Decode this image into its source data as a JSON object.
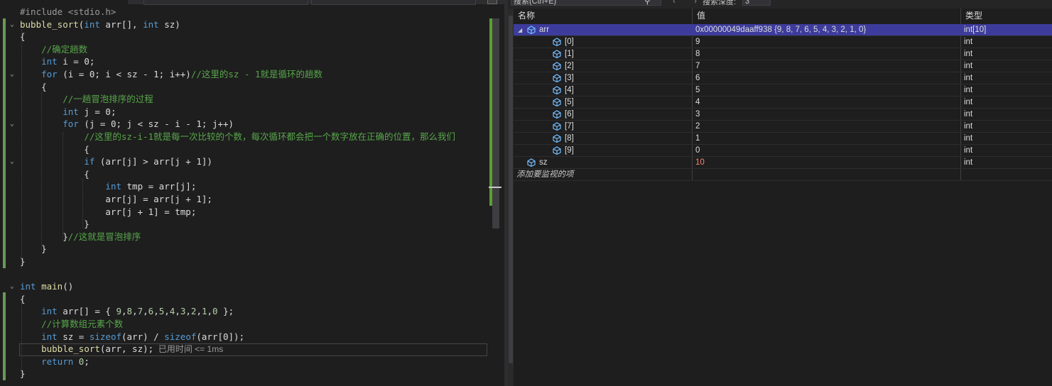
{
  "editor": {
    "lines": [
      {
        "fold": "",
        "html": [
          [
            "pp",
            "#include <stdio.h>"
          ]
        ]
      },
      {
        "fold": "v",
        "html": [
          [
            "fn",
            "bubble_sort"
          ],
          [
            "id",
            "("
          ],
          [
            "kw",
            "int"
          ],
          [
            "id",
            " arr[], "
          ],
          [
            "kw",
            "int"
          ],
          [
            "id",
            " sz)"
          ]
        ]
      },
      {
        "fold": "",
        "html": [
          [
            "id",
            "{"
          ]
        ]
      },
      {
        "fold": "",
        "html": [
          [
            "id",
            "    "
          ],
          [
            "cm",
            "//确定趟数"
          ]
        ]
      },
      {
        "fold": "",
        "html": [
          [
            "id",
            "    "
          ],
          [
            "kw",
            "int"
          ],
          [
            "id",
            " i = 0;"
          ]
        ]
      },
      {
        "fold": "v",
        "html": [
          [
            "id",
            "    "
          ],
          [
            "kw",
            "for"
          ],
          [
            "id",
            " (i = 0; i < sz - 1; i++)"
          ],
          [
            "cm",
            "//这里的sz - 1就是循环的趟数"
          ]
        ]
      },
      {
        "fold": "",
        "html": [
          [
            "id",
            "    {"
          ]
        ]
      },
      {
        "fold": "",
        "html": [
          [
            "id",
            "        "
          ],
          [
            "cm",
            "//一趟冒泡排序的过程"
          ]
        ]
      },
      {
        "fold": "",
        "html": [
          [
            "id",
            "        "
          ],
          [
            "kw",
            "int"
          ],
          [
            "id",
            " j = 0;"
          ]
        ]
      },
      {
        "fold": "v",
        "html": [
          [
            "id",
            "        "
          ],
          [
            "kw",
            "for"
          ],
          [
            "id",
            " (j = 0; j < sz - i - 1; j++)"
          ]
        ]
      },
      {
        "fold": "",
        "html": [
          [
            "id",
            "            "
          ],
          [
            "cm",
            "//这里的sz-i-1就是每一次比较的个数，每次循环都会把一个数字放在正确的位置，那么我们"
          ]
        ]
      },
      {
        "fold": "",
        "html": [
          [
            "id",
            "            {"
          ]
        ]
      },
      {
        "fold": "v",
        "html": [
          [
            "id",
            "            "
          ],
          [
            "kw",
            "if"
          ],
          [
            "id",
            " (arr[j] > arr[j + 1])"
          ]
        ]
      },
      {
        "fold": "",
        "html": [
          [
            "id",
            "            {"
          ]
        ]
      },
      {
        "fold": "",
        "html": [
          [
            "id",
            "                "
          ],
          [
            "kw",
            "int"
          ],
          [
            "id",
            " tmp = arr[j];"
          ]
        ]
      },
      {
        "fold": "",
        "html": [
          [
            "id",
            "                arr[j] = arr[j + 1];"
          ]
        ]
      },
      {
        "fold": "",
        "html": [
          [
            "id",
            "                arr[j + 1] = tmp;"
          ]
        ]
      },
      {
        "fold": "",
        "html": [
          [
            "id",
            "            }"
          ]
        ]
      },
      {
        "fold": "",
        "html": [
          [
            "id",
            "        }"
          ],
          [
            "cm",
            "//这就是冒泡排序"
          ]
        ]
      },
      {
        "fold": "",
        "html": [
          [
            "id",
            "    }"
          ]
        ]
      },
      {
        "fold": "",
        "html": [
          [
            "id",
            "}"
          ]
        ]
      },
      {
        "fold": "",
        "html": [
          [
            "id",
            ""
          ]
        ]
      },
      {
        "fold": "v",
        "html": [
          [
            "kw",
            "int"
          ],
          [
            "id",
            " "
          ],
          [
            "fn",
            "main"
          ],
          [
            "id",
            "()"
          ]
        ]
      },
      {
        "fold": "",
        "html": [
          [
            "id",
            "{"
          ]
        ]
      },
      {
        "fold": "",
        "html": [
          [
            "id",
            "    "
          ],
          [
            "kw",
            "int"
          ],
          [
            "id",
            " arr[] = { "
          ],
          [
            "nm",
            "9"
          ],
          [
            "id",
            ","
          ],
          [
            "nm",
            "8"
          ],
          [
            "id",
            ","
          ],
          [
            "nm",
            "7"
          ],
          [
            "id",
            ","
          ],
          [
            "nm",
            "6"
          ],
          [
            "id",
            ","
          ],
          [
            "nm",
            "5"
          ],
          [
            "id",
            ","
          ],
          [
            "nm",
            "4"
          ],
          [
            "id",
            ","
          ],
          [
            "nm",
            "3"
          ],
          [
            "id",
            ","
          ],
          [
            "nm",
            "2"
          ],
          [
            "id",
            ","
          ],
          [
            "nm",
            "1"
          ],
          [
            "id",
            ","
          ],
          [
            "nm",
            "0"
          ],
          [
            "id",
            " };"
          ]
        ]
      },
      {
        "fold": "",
        "html": [
          [
            "id",
            "    "
          ],
          [
            "cm",
            "//计算数组元素个数"
          ]
        ]
      },
      {
        "fold": "",
        "html": [
          [
            "id",
            "    "
          ],
          [
            "kw",
            "int"
          ],
          [
            "id",
            " sz = "
          ],
          [
            "kw",
            "sizeof"
          ],
          [
            "id",
            "(arr) / "
          ],
          [
            "kw",
            "sizeof"
          ],
          [
            "id",
            "(arr[0]);"
          ]
        ]
      },
      {
        "fold": "",
        "html": [
          [
            "id",
            "    "
          ],
          [
            "fn",
            "bubble_sort"
          ],
          [
            "id",
            "(arr, sz);"
          ]
        ]
      },
      {
        "fold": "",
        "html": [
          [
            "id",
            "    "
          ],
          [
            "kw",
            "return"
          ],
          [
            "id",
            " "
          ],
          [
            "nm",
            "0"
          ],
          [
            "id",
            ";"
          ]
        ]
      },
      {
        "fold": "",
        "html": [
          [
            "id",
            "}"
          ]
        ]
      }
    ],
    "elapsed_hint": "已用时间 <= 1ms"
  },
  "watch": {
    "search_placeholder": "搜索(Ctrl+E)",
    "depth_label": "搜索深度:",
    "depth_value": "3",
    "headers": {
      "name": "名称",
      "value": "值",
      "type": "类型"
    },
    "rows": [
      {
        "name": "arr",
        "value": "0x00000049daaff938 {9, 8, 7, 6, 5, 4, 3, 2, 1, 0}",
        "type": "int[10]",
        "level": 0,
        "expanded": true,
        "selected": true,
        "changed": false
      },
      {
        "name": "[0]",
        "value": "9",
        "type": "int",
        "level": 1,
        "changed": false
      },
      {
        "name": "[1]",
        "value": "8",
        "type": "int",
        "level": 1,
        "changed": false
      },
      {
        "name": "[2]",
        "value": "7",
        "type": "int",
        "level": 1,
        "changed": false
      },
      {
        "name": "[3]",
        "value": "6",
        "type": "int",
        "level": 1,
        "changed": false
      },
      {
        "name": "[4]",
        "value": "5",
        "type": "int",
        "level": 1,
        "changed": false
      },
      {
        "name": "[5]",
        "value": "4",
        "type": "int",
        "level": 1,
        "changed": false
      },
      {
        "name": "[6]",
        "value": "3",
        "type": "int",
        "level": 1,
        "changed": false
      },
      {
        "name": "[7]",
        "value": "2",
        "type": "int",
        "level": 1,
        "changed": false
      },
      {
        "name": "[8]",
        "value": "1",
        "type": "int",
        "level": 1,
        "changed": false
      },
      {
        "name": "[9]",
        "value": "0",
        "type": "int",
        "level": 1,
        "changed": false
      },
      {
        "name": "sz",
        "value": "10",
        "type": "int",
        "level": 0,
        "changed": true
      }
    ],
    "add_item": "添加要监视的项"
  },
  "colors": {
    "accent_selection": "#3d3c9c",
    "changed_value": "#f48771",
    "comment": "#57a64a",
    "keyword": "#569cd6"
  }
}
